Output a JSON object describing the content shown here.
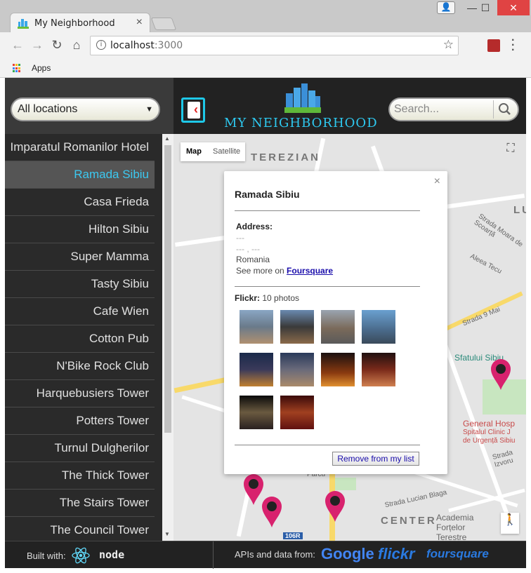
{
  "browser": {
    "tab_title": "My Neighborhood",
    "tab_close": "×",
    "url_host": "localhost",
    "url_port": ":3000",
    "bookmarks_apps": "Apps",
    "window_minimize": "—",
    "window_maximize": "☐",
    "window_close": "✕"
  },
  "header": {
    "filter_value": "All locations",
    "brand": "MY NEIGHBORHOOD",
    "search_placeholder": "Search..."
  },
  "locations": [
    {
      "name": "Imparatul Romanilor Hotel",
      "active": false
    },
    {
      "name": "Ramada Sibiu",
      "active": true
    },
    {
      "name": "Casa Frieda",
      "active": false
    },
    {
      "name": "Hilton Sibiu",
      "active": false
    },
    {
      "name": "Super Mamma",
      "active": false
    },
    {
      "name": "Tasty Sibiu",
      "active": false
    },
    {
      "name": "Cafe Wien",
      "active": false
    },
    {
      "name": "Cotton Pub",
      "active": false
    },
    {
      "name": "N'Bike Rock Club",
      "active": false
    },
    {
      "name": "Harquebusiers Tower",
      "active": false
    },
    {
      "name": "Potters Tower",
      "active": false
    },
    {
      "name": "Turnul Dulgherilor",
      "active": false
    },
    {
      "name": "The Thick Tower",
      "active": false
    },
    {
      "name": "The Stairs Tower",
      "active": false
    },
    {
      "name": "The Council Tower",
      "active": false
    }
  ],
  "map": {
    "type_map": "Map",
    "type_satellite": "Satellite",
    "labels": {
      "terezian": "TEREZIAN",
      "center": "CENTER",
      "lu": "LU",
      "aleea_tecu": "Aleea Tecu",
      "strada_9_mai": "Strada 9 Mai",
      "sfatului": "Sfatului Sibiu",
      "general_hosp": "General Hosp",
      "spitalul": "Spitalul Clinic J",
      "urgenta": "de Urgență Sibiu",
      "academia": "Academia",
      "fortelor": "Forțelor",
      "terestre": "Terestre",
      "road_106r": "106R",
      "parcu": "Parcu",
      "lucian_blaga": "Strada Lucian Blaga",
      "str_izvorul": "Strada Izvoru",
      "str_moara": "Strada Moara de Scoarță"
    }
  },
  "infowindow": {
    "title": "Ramada Sibiu",
    "address_label": "Address:",
    "address_line1": "---",
    "address_line2": "--- , ---",
    "country": "Romania",
    "see_more_prefix": "See more on ",
    "see_more_link": "Foursquare",
    "flickr_label": "Flickr:",
    "flickr_count": " 10 photos",
    "remove_button": "Remove from my list",
    "close": "×"
  },
  "footer": {
    "built_with": "Built with:",
    "apis_label": "APIs and data from:",
    "google": "Google",
    "flickr": "flickr",
    "foursquare": "foursquare",
    "node": "node"
  },
  "colors": {
    "accent": "#2ec9f0",
    "marker": "#d8226e",
    "toggle_border": "#1ec8e8"
  }
}
